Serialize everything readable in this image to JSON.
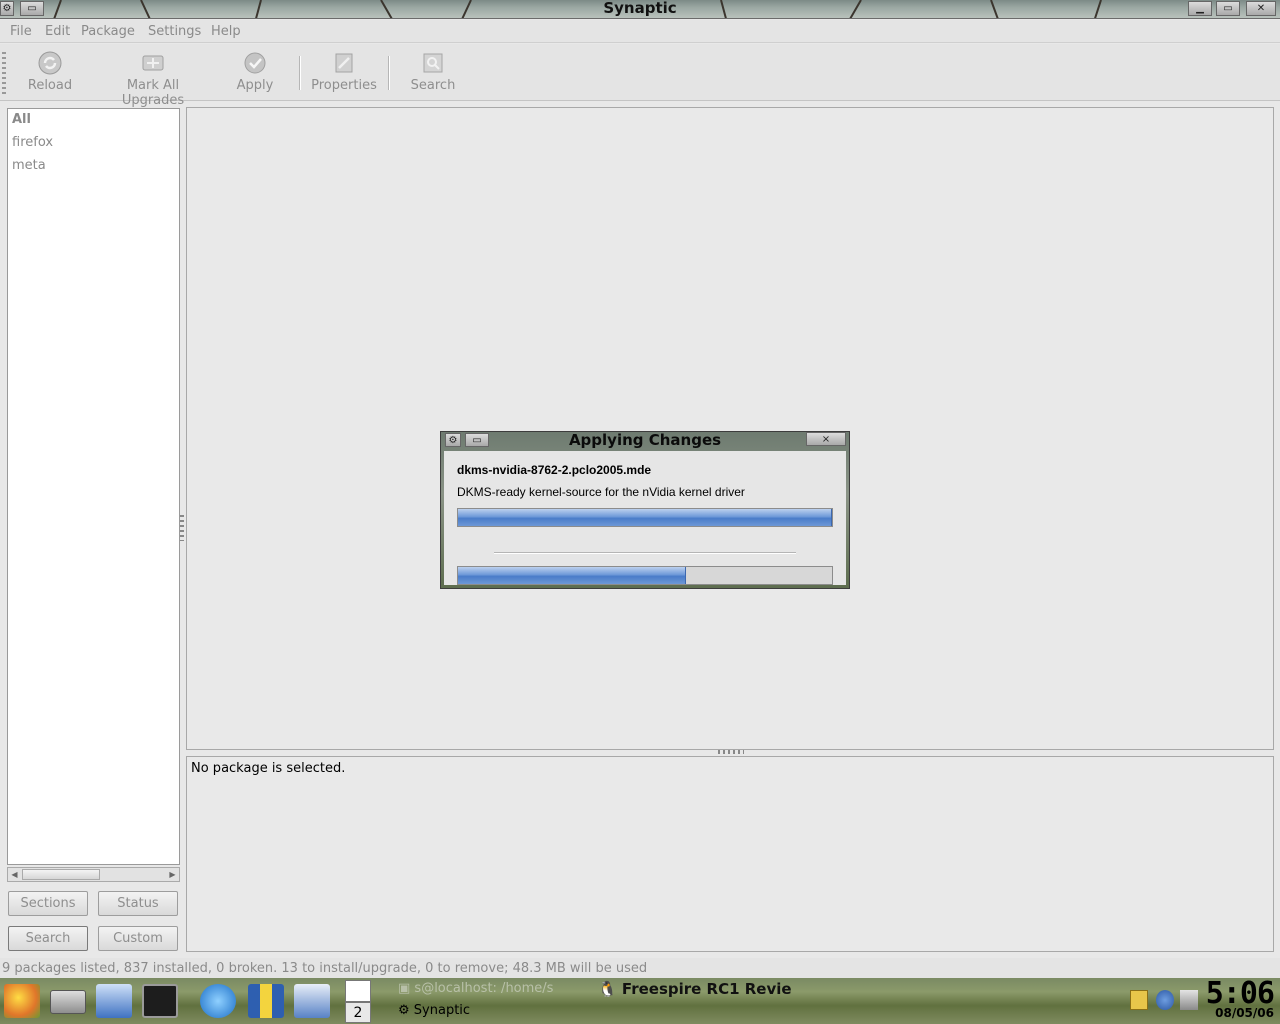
{
  "window": {
    "title": "Synaptic",
    "controls": [
      "minimize",
      "maximize",
      "close"
    ]
  },
  "menubar": {
    "items": [
      "File",
      "Edit",
      "Package",
      "Settings",
      "Help"
    ]
  },
  "toolbar": {
    "items": [
      {
        "label": "Reload",
        "icon": "reload-icon"
      },
      {
        "label": "Mark All Upgrades",
        "icon": "mark-upgrades-icon"
      },
      {
        "label": "Apply",
        "icon": "apply-check-icon"
      },
      {
        "label": "Properties",
        "icon": "properties-icon"
      },
      {
        "label": "Search",
        "icon": "search-icon"
      }
    ]
  },
  "sidebar": {
    "filters": [
      "All",
      "firefox",
      "meta"
    ],
    "buttons": [
      "Sections",
      "Status",
      "Search",
      "Custom"
    ]
  },
  "description": {
    "text": "No package is selected."
  },
  "statusbar": {
    "text": "9 packages listed, 837 installed, 0 broken. 13 to install/upgrade, 0 to remove; 48.3 MB will be used"
  },
  "dialog": {
    "title": "Applying Changes",
    "package_name": "dkms-nvidia-8762-2.pclo2005.mde",
    "package_description": "DKMS-ready kernel-source for the nVidia kernel driver",
    "progress_primary": 1.0,
    "progress_overall": 0.61,
    "close_label": "×"
  },
  "taskbar": {
    "pager_number": "2",
    "tasks": [
      {
        "label": "s@localhost: /home/s",
        "state": "inactive"
      },
      {
        "label": "Freespire RC1 Revie",
        "state": "bold"
      },
      {
        "label": "Synaptic",
        "state": "active"
      }
    ],
    "clock": {
      "time": "5:06",
      "date": "08/05/06"
    }
  }
}
